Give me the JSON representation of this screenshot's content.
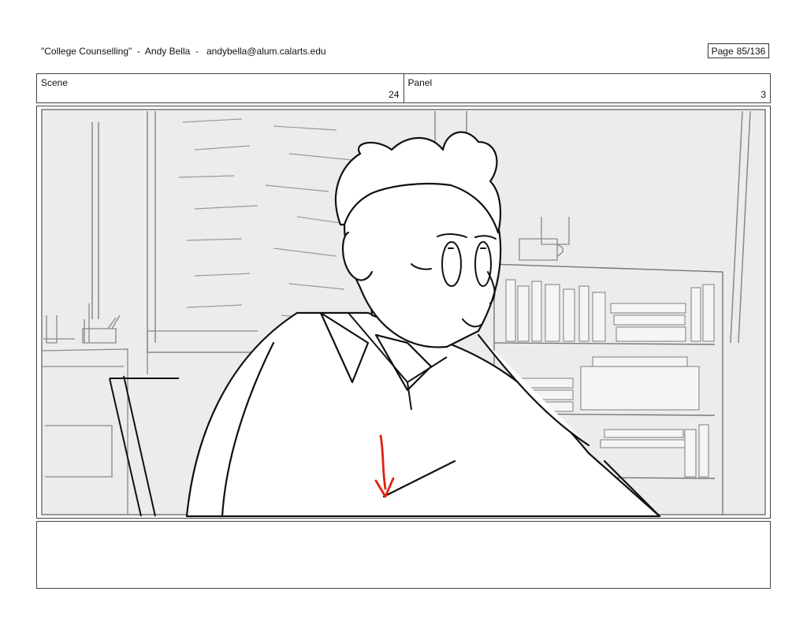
{
  "header": {
    "title": "\"College Counselling\"  -  Andy Bella  -   andybella@alum.calarts.edu",
    "page_label": "Page",
    "page_value": "85/136"
  },
  "scene": {
    "label": "Scene",
    "value": "24"
  },
  "panel": {
    "label": "Panel",
    "value": "3"
  },
  "notes": {
    "text": ""
  }
}
